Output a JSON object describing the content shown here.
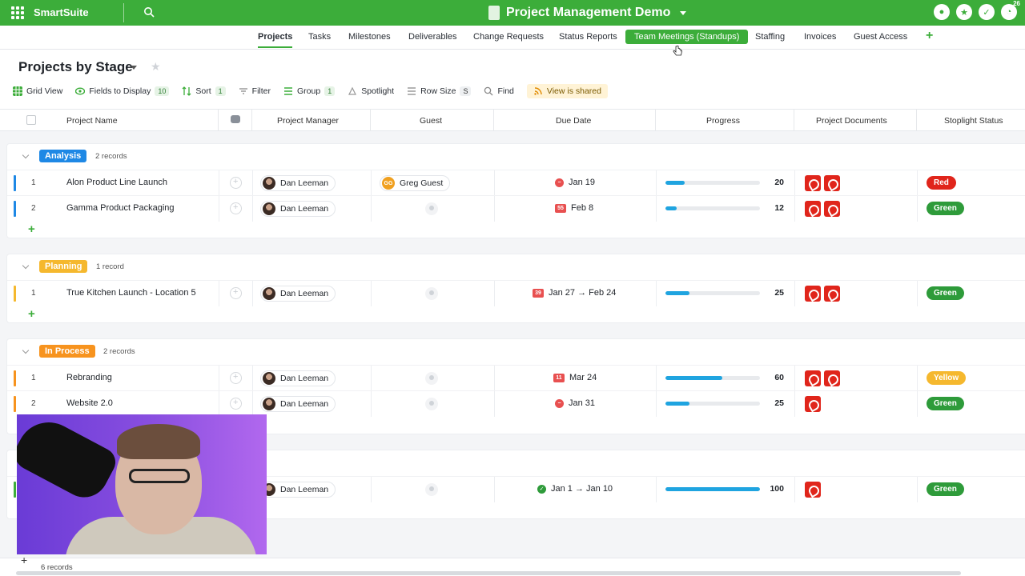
{
  "app": {
    "brand": "SmartSuite",
    "workspace_title": "Project Management Demo",
    "notification_count": "26"
  },
  "tabs": [
    {
      "label": "Projects",
      "state": "active"
    },
    {
      "label": "Tasks"
    },
    {
      "label": "Milestones"
    },
    {
      "label": "Deliverables"
    },
    {
      "label": "Change Requests"
    },
    {
      "label": "Status Reports"
    },
    {
      "label": "Team Meetings (Standups)",
      "state": "hover"
    },
    {
      "label": "Staffing"
    },
    {
      "label": "Invoices"
    },
    {
      "label": "Guest Access"
    }
  ],
  "view": {
    "title": "Projects by Stage",
    "toolbar": {
      "grid_view": "Grid View",
      "fields": "Fields to Display",
      "fields_count": "10",
      "sort": "Sort",
      "sort_count": "1",
      "filter": "Filter",
      "group": "Group",
      "group_count": "1",
      "spotlight": "Spotlight",
      "row_size": "Row Size",
      "row_size_value": "S",
      "find": "Find",
      "shared": "View is shared"
    }
  },
  "columns": {
    "project_name": "Project Name",
    "project_manager": "Project Manager",
    "guest": "Guest",
    "due_date": "Due Date",
    "progress": "Progress",
    "project_documents": "Project Documents",
    "stoplight_status": "Stoplight Status"
  },
  "colors": {
    "brand_green": "#3cad3a",
    "analysis": "#1e88e5",
    "planning": "#f5b82e",
    "in_process": "#f7931e",
    "complete": "#3cad3a",
    "status_red": "#e0251b",
    "status_green": "#2e9b3a",
    "status_yellow": "#f5b82e",
    "progress_bar": "#1fa4e0"
  },
  "groups": [
    {
      "label": "Analysis",
      "count": "2 records",
      "rows": [
        {
          "num": "1",
          "name": "Alon Product Line Launch",
          "manager": "Dan Leeman",
          "guest": "Greg Guest",
          "guest_initials": "GG",
          "due_icon": "overdue",
          "due_badge": "",
          "due": "Jan 19",
          "progress": 20,
          "progress_label": "20",
          "docs": 2,
          "status": "Red"
        },
        {
          "num": "2",
          "name": "Gamma Product Packaging",
          "manager": "Dan Leeman",
          "guest": "",
          "guest_initials": "",
          "due_icon": "badge",
          "due_badge": "55",
          "due": "Feb 8",
          "progress": 12,
          "progress_label": "12",
          "docs": 2,
          "status": "Green"
        }
      ]
    },
    {
      "label": "Planning",
      "count": "1 record",
      "rows": [
        {
          "num": "1",
          "name": "True Kitchen Launch - Location 5",
          "manager": "Dan Leeman",
          "guest": "",
          "guest_initials": "",
          "due_icon": "badge",
          "due_badge": "39",
          "due": "Jan 27 → Feb 24",
          "progress": 25,
          "progress_label": "25",
          "docs": 2,
          "status": "Green"
        }
      ]
    },
    {
      "label": "In Process",
      "count": "2 records",
      "rows": [
        {
          "num": "1",
          "name": "Rebranding",
          "manager": "Dan Leeman",
          "guest": "",
          "guest_initials": "",
          "due_icon": "badge",
          "due_badge": "11",
          "due": "Mar 24",
          "progress": 60,
          "progress_label": "60",
          "docs": 2,
          "status": "Yellow"
        },
        {
          "num": "2",
          "name": "Website 2.0",
          "manager": "Dan Leeman",
          "guest": "",
          "guest_initials": "",
          "due_icon": "overdue",
          "due_badge": "",
          "due": "Jan 31",
          "progress": 25,
          "progress_label": "25",
          "docs": 1,
          "status": "Green"
        }
      ]
    },
    {
      "label": "",
      "count": "",
      "rows": [
        {
          "num": "",
          "name": "",
          "manager": "Dan Leeman",
          "guest": "",
          "guest_initials": "",
          "due_icon": "check",
          "due_badge": "",
          "due": "Jan 1 → Jan 10",
          "progress": 100,
          "progress_label": "100",
          "docs": 1,
          "status": "Green"
        }
      ]
    }
  ],
  "footer": {
    "records": "6 records"
  }
}
